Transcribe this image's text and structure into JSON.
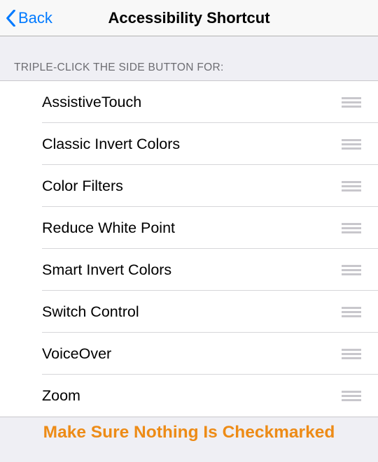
{
  "nav": {
    "back_label": "Back",
    "title": "Accessibility Shortcut"
  },
  "section_header": "Triple-click the side button for:",
  "items": [
    {
      "label": "AssistiveTouch"
    },
    {
      "label": "Classic Invert Colors"
    },
    {
      "label": "Color Filters"
    },
    {
      "label": "Reduce White Point"
    },
    {
      "label": "Smart Invert Colors"
    },
    {
      "label": "Switch Control"
    },
    {
      "label": "VoiceOver"
    },
    {
      "label": "Zoom"
    }
  ],
  "footer_note": "Make Sure Nothing Is Checkmarked"
}
